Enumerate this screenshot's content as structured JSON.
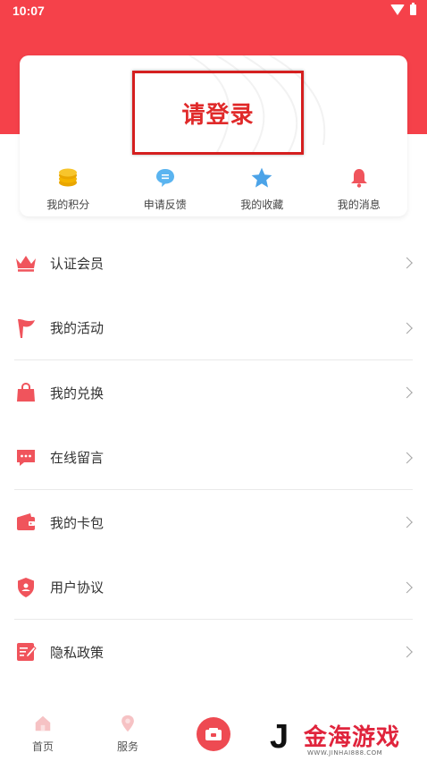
{
  "status_bar": {
    "time": "10:07",
    "wifi_icon": "wifi-icon",
    "battery_icon": "battery-icon"
  },
  "colors": {
    "brand_red": "#f5414a",
    "login_text": "#e02a2a",
    "highlight_box": "#d51f1f",
    "coin_yellow": "#f4b400",
    "chat_blue": "#5ab4f0",
    "star_blue": "#4ba3e8",
    "bell_red": "#f0545c"
  },
  "profile_card": {
    "login_label": "请登录",
    "quick_actions": [
      {
        "label": "我的积分",
        "icon": "coins-icon"
      },
      {
        "label": "申请反馈",
        "icon": "chat-bubble-icon"
      },
      {
        "label": "我的收藏",
        "icon": "star-icon"
      },
      {
        "label": "我的消息",
        "icon": "bell-icon"
      }
    ]
  },
  "menu": [
    {
      "label": "认证会员",
      "icon": "crown-icon"
    },
    {
      "label": "我的活动",
      "icon": "flag-icon"
    },
    {
      "label": "我的兑换",
      "icon": "shopping-bag-icon"
    },
    {
      "label": "在线留言",
      "icon": "message-icon"
    },
    {
      "label": "我的卡包",
      "icon": "wallet-icon"
    },
    {
      "label": "用户协议",
      "icon": "shield-user-icon"
    },
    {
      "label": "隐私政策",
      "icon": "document-edit-icon"
    }
  ],
  "tab_bar": {
    "tabs": [
      {
        "label": "首页",
        "icon": "home-icon"
      },
      {
        "label": "服务",
        "icon": "service-icon"
      }
    ],
    "center_icon": "ticket-icon"
  },
  "watermark": {
    "mark": "J",
    "text": "金海游戏",
    "url": "WWW.JINHAI888.COM"
  }
}
